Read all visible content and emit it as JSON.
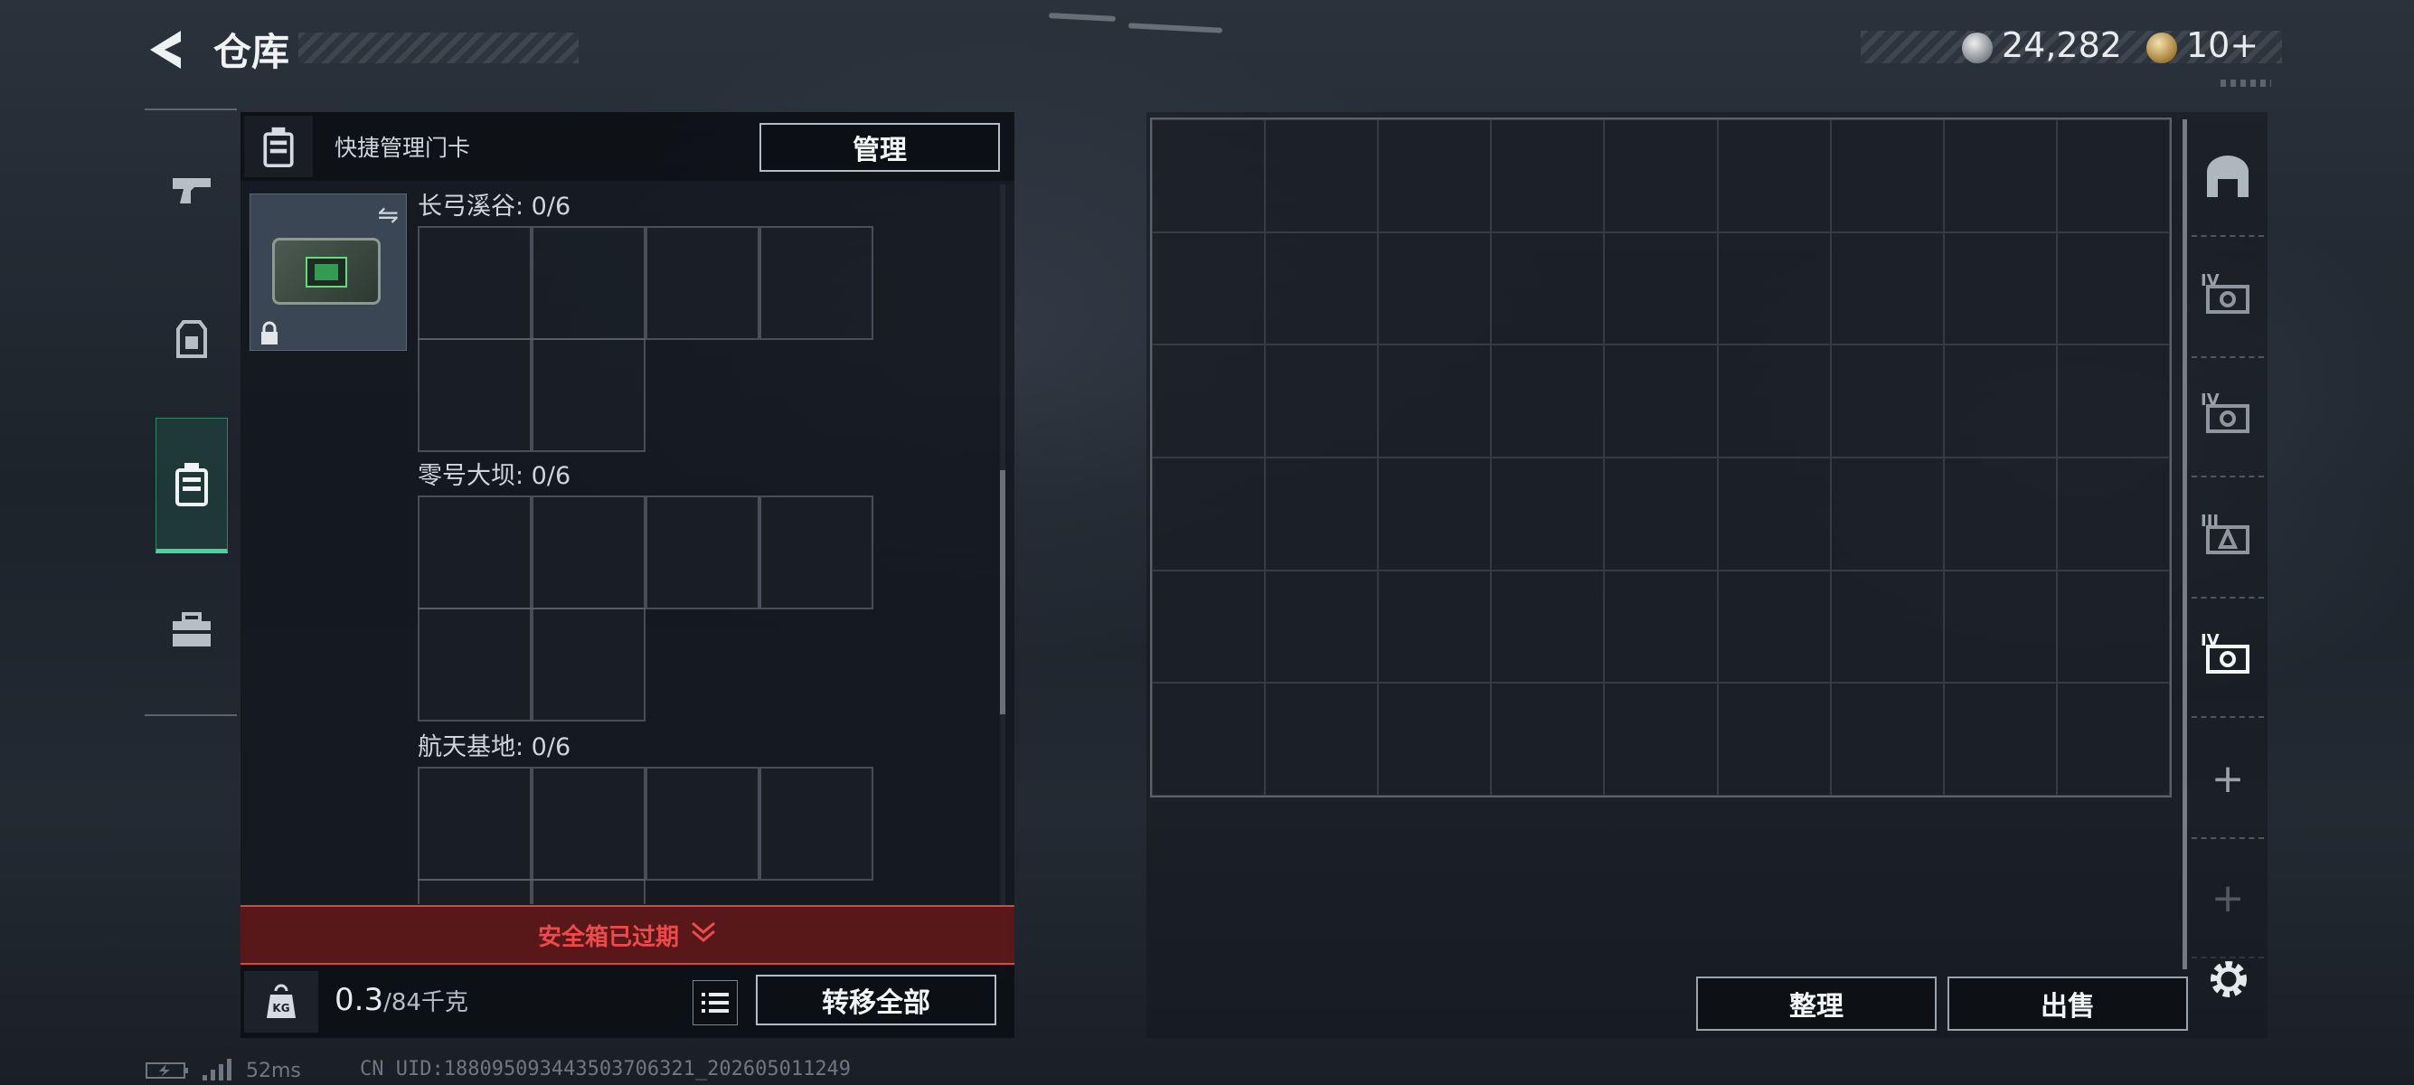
{
  "header": {
    "title": "仓库",
    "currency": [
      {
        "icon": "silver-coin-icon",
        "value": "24,282"
      },
      {
        "icon": "gold-coin-icon",
        "value": "10+"
      }
    ]
  },
  "left_rail": {
    "items": [
      {
        "name": "weapons",
        "icon": "pistol-icon"
      },
      {
        "name": "equipment",
        "icon": "backpack-armor-icon"
      },
      {
        "name": "safe-box",
        "icon": "safe-case-icon",
        "active": true
      },
      {
        "name": "tools",
        "icon": "toolbox-icon"
      }
    ]
  },
  "left_panel": {
    "header_label": "快捷管理门卡",
    "manage_label": "管理",
    "maps": [
      {
        "label": "长弓溪谷: 0/6"
      },
      {
        "label": "零号大坝: 0/6"
      },
      {
        "label": "航天基地: 0/6"
      }
    ],
    "expired_label": "安全箱已过期",
    "weight_value": "0.3",
    "weight_max": "/84千克",
    "transfer_label": "转移全部"
  },
  "right_panel": {
    "sort_label": "整理",
    "sell_label": "出售",
    "tabs": [
      {
        "icon": "home-arch-icon",
        "roman": ""
      },
      {
        "icon": "stash-case-icon",
        "roman": "IV"
      },
      {
        "icon": "stash-case-icon",
        "roman": "IV"
      },
      {
        "icon": "stash-case-icon",
        "roman": "III"
      },
      {
        "icon": "stash-case-icon",
        "roman": "IV",
        "active": true
      },
      {
        "icon": "plus-icon",
        "roman": ""
      },
      {
        "icon": "plus-icon",
        "roman": ""
      }
    ]
  },
  "status_bar": {
    "ping": "52ms",
    "uid": "CN UID:1880950934435037063​21_202605011249"
  },
  "colors": {
    "accent_green": "#45d49a",
    "alert_red": "#ee4a4a"
  }
}
